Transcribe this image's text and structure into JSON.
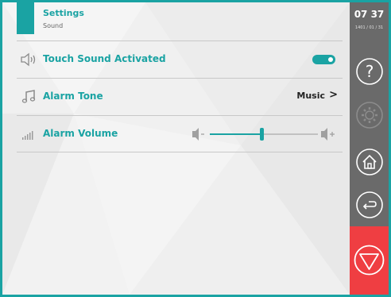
{
  "header": {
    "title": "Settings",
    "subtitle": "Sound"
  },
  "rows": [
    {
      "label": "Touch Sound Activated",
      "icon": "speaker-icon",
      "control": "toggle",
      "toggle_on": true
    },
    {
      "label": "Alarm Tone",
      "icon": "music-note-icon",
      "value": "Music",
      "chevron": ">"
    },
    {
      "label": "Alarm Volume",
      "icon": "volume-bars-icon",
      "control": "slider",
      "slider_level": 0.5
    }
  ],
  "sidebar": {
    "time": "07 37",
    "date": "1401 / 01 / 31",
    "buttons": [
      "help-icon",
      "gear-icon",
      "home-icon",
      "back-icon",
      "stop-icon"
    ]
  },
  "colors": {
    "accent": "#1aa3a3",
    "sidebar": "#6a6a6a",
    "stop": "#ef3e42"
  }
}
